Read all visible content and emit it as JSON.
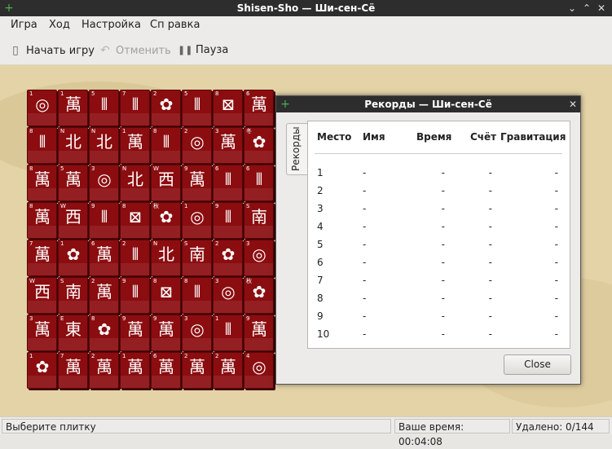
{
  "window": {
    "title": "Shisen-Sho — Ши-сен-Сё",
    "min_glyph": "⌄",
    "max_glyph": "⌃",
    "close_glyph": "✕",
    "app_icon_glyph": "+"
  },
  "menu": [
    "Игра",
    "Ход",
    "Настройка",
    "Сп равка"
  ],
  "toolbar": {
    "new_game": {
      "label": "Начать игру",
      "icon": "new-document-icon",
      "glyph": "▯"
    },
    "undo": {
      "label": "Отменить",
      "icon": "undo-icon",
      "glyph": "↶",
      "enabled": false
    },
    "pause": {
      "label": "Пауза",
      "icon": "pause-icon",
      "glyph": "❚❚"
    }
  },
  "board": {
    "tiles": [
      [
        "◎",
        "萬",
        "⦀",
        "⦀",
        "✿",
        "⦀",
        "⊠",
        "萬"
      ],
      [
        "⦀",
        "北",
        "北",
        "萬",
        "⦀",
        "◎",
        "萬",
        "✿"
      ],
      [
        "萬",
        "萬",
        "◎",
        "北",
        "西",
        "萬",
        "⦀",
        "⦀"
      ],
      [
        "萬",
        "西",
        "⦀",
        "⊠",
        "✿",
        "◎",
        "⦀",
        "南"
      ],
      [
        "萬",
        "✿",
        "萬",
        "⦀",
        "北",
        "南",
        "✿",
        "◎"
      ],
      [
        "西",
        "南",
        "萬",
        "⦀",
        "⊠",
        "⦀",
        "◎",
        "✿"
      ],
      [
        "萬",
        "東",
        "✿",
        "萬",
        "萬",
        "◎",
        "⦀",
        "萬"
      ],
      [
        "✿",
        "萬",
        "萬",
        "萬",
        "萬",
        "萬",
        "萬",
        "◎"
      ]
    ],
    "marks": [
      [
        "1",
        "1",
        "5",
        "7",
        "2",
        "5",
        "8",
        "6"
      ],
      [
        "8",
        "N",
        "N",
        "1",
        "8",
        "2",
        "3",
        "冬"
      ],
      [
        "8",
        "5",
        "3",
        "N",
        "W",
        "9",
        "6",
        "6"
      ],
      [
        "8",
        "W",
        "9",
        "8",
        "秋",
        "1",
        "9",
        "S"
      ],
      [
        "7",
        "1",
        "6",
        "2",
        "N",
        "S",
        "2",
        "3"
      ],
      [
        "W",
        "S",
        "2",
        "9",
        "8",
        "8",
        "3",
        "秋"
      ],
      [
        "3",
        "E",
        "8",
        "9",
        "9",
        "3",
        "1",
        "9"
      ],
      [
        "1",
        "7",
        "2",
        "1",
        "6",
        "2",
        "2",
        "4"
      ]
    ]
  },
  "dialog": {
    "title": "Рекорды — Ши-сен-Сё",
    "tab_label": "Рекорды",
    "columns": [
      "Место",
      "Имя",
      "Время",
      "Счёт",
      "Гравитация"
    ],
    "rows": [
      [
        "1",
        "-",
        "-",
        "-",
        "-"
      ],
      [
        "2",
        "-",
        "-",
        "-",
        "-"
      ],
      [
        "3",
        "-",
        "-",
        "-",
        "-"
      ],
      [
        "4",
        "-",
        "-",
        "-",
        "-"
      ],
      [
        "5",
        "-",
        "-",
        "-",
        "-"
      ],
      [
        "6",
        "-",
        "-",
        "-",
        "-"
      ],
      [
        "7",
        "-",
        "-",
        "-",
        "-"
      ],
      [
        "8",
        "-",
        "-",
        "-",
        "-"
      ],
      [
        "9",
        "-",
        "-",
        "-",
        "-"
      ],
      [
        "10",
        "-",
        "-",
        "-",
        "-"
      ]
    ],
    "close_label": "Close",
    "icon_glyph": "+",
    "close_glyph": "✕"
  },
  "status": {
    "message": "Выберите плитку",
    "time": "Ваше время: 00:04:08",
    "removed": "Удалено: 0/144"
  },
  "colors": {
    "tile": "#8b0d10",
    "board": "#e3d3a6",
    "titlebar": "#2d2d2d"
  }
}
